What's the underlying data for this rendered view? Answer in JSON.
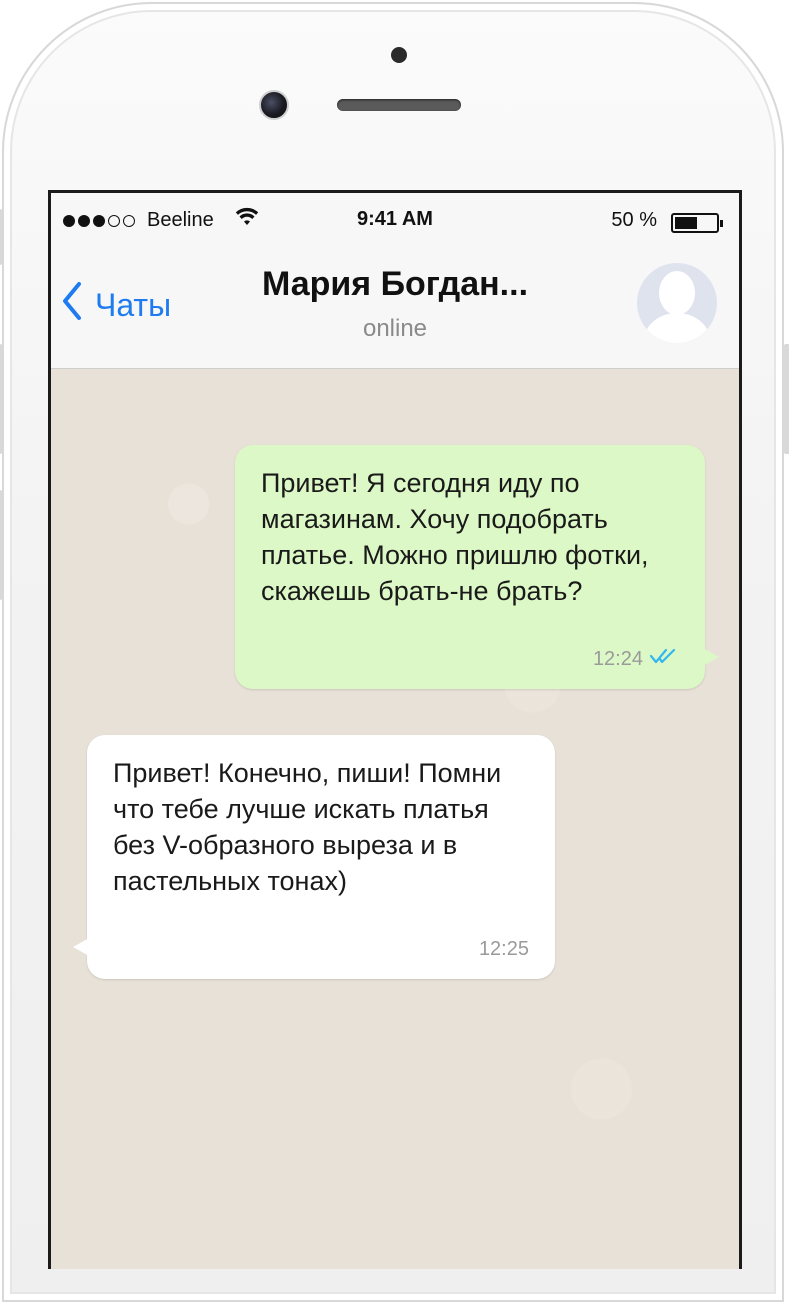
{
  "status_bar": {
    "carrier": "Beeline",
    "time": "9:41 AM",
    "battery_percent": "50 %",
    "battery_level": 0.5,
    "signal_bars": 3,
    "signal_icon": "signal-dots-icon",
    "wifi_icon": "wifi-icon",
    "battery_icon": "battery-icon"
  },
  "header": {
    "back_label": "Чаты",
    "back_icon": "chevron-left-icon",
    "contact_name": "Мария Богдан...",
    "contact_status": "online",
    "avatar_icon": "default-avatar-icon"
  },
  "colors": {
    "accent": "#1e7cf0",
    "outgoing_bubble": "#dcf8c6",
    "incoming_bubble": "#ffffff",
    "read_ticks": "#34b7f1"
  },
  "messages": [
    {
      "direction": "outgoing",
      "text": "Привет! Я сегодня иду по магазинам. Хочу подобрать платье. Можно пришлю фотки, скажешь брать-не брать?",
      "time": "12:24",
      "status_icon": "double-check-icon"
    },
    {
      "direction": "incoming",
      "text": "Привет! Конечно, пиши! Помни что тебе лучше искать платья без V-образного выреза и в пастельных тонах)",
      "time": "12:25"
    }
  ]
}
